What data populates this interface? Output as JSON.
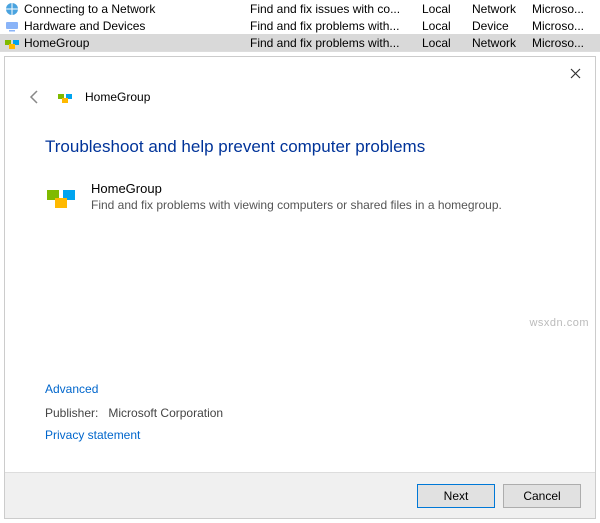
{
  "list": {
    "rows": [
      {
        "name": "Connecting to a Network",
        "desc": "Find and fix issues with co...",
        "location": "Local",
        "category": "Network",
        "publisher": "Microso..."
      },
      {
        "name": "Hardware and Devices",
        "desc": "Find and fix problems with...",
        "location": "Local",
        "category": "Device",
        "publisher": "Microso..."
      },
      {
        "name": "HomeGroup",
        "desc": "Find and fix problems with...",
        "location": "Local",
        "category": "Network",
        "publisher": "Microso..."
      }
    ]
  },
  "dialog": {
    "breadcrumb": "HomeGroup",
    "heading": "Troubleshoot and help prevent computer problems",
    "item_title": "HomeGroup",
    "item_desc": "Find and fix problems with viewing computers or shared files in a homegroup.",
    "advanced": "Advanced",
    "publisher_label": "Publisher:",
    "publisher_value": "Microsoft Corporation",
    "privacy": "Privacy statement",
    "next": "Next",
    "cancel": "Cancel"
  },
  "watermark": "wsxdn.com"
}
